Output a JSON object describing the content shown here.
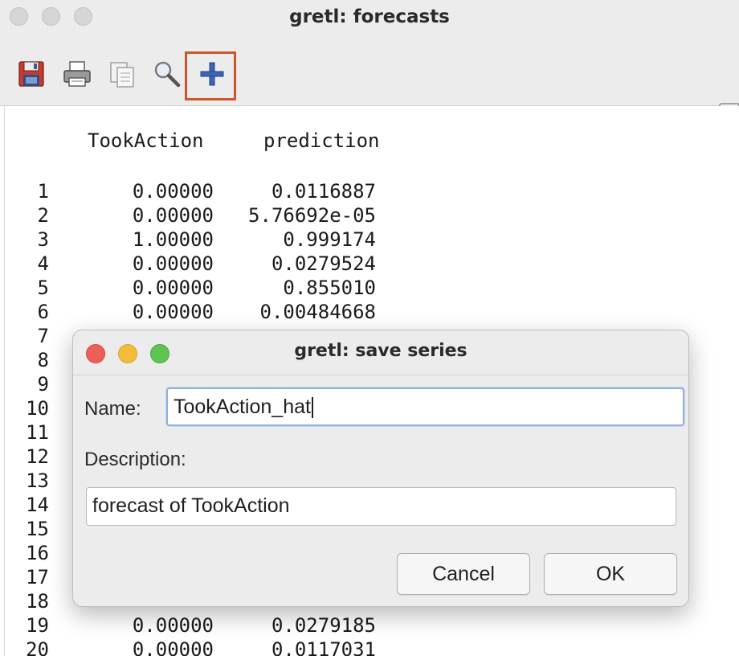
{
  "window": {
    "title": "gretl: forecasts"
  },
  "toolbar": {
    "items": [
      {
        "icon": "save-icon"
      },
      {
        "icon": "print-icon"
      },
      {
        "icon": "copy-icon"
      },
      {
        "icon": "find-icon"
      },
      {
        "icon": "add-series-icon"
      }
    ]
  },
  "table": {
    "headers": [
      "TookAction",
      "prediction"
    ],
    "rows": [
      {
        "n": "1",
        "took": "0.00000",
        "pred": "0.0116887"
      },
      {
        "n": "2",
        "took": "0.00000",
        "pred": "5.76692e-05"
      },
      {
        "n": "3",
        "took": "1.00000",
        "pred": "0.999174"
      },
      {
        "n": "4",
        "took": "0.00000",
        "pred": "0.0279524"
      },
      {
        "n": "5",
        "took": "0.00000",
        "pred": "0.855010"
      },
      {
        "n": "6",
        "took": "0.00000",
        "pred": "0.00484668"
      },
      {
        "n": "7",
        "took": "",
        "pred": ""
      },
      {
        "n": "8",
        "took": "",
        "pred": ""
      },
      {
        "n": "9",
        "took": "",
        "pred": ""
      },
      {
        "n": "10",
        "took": "",
        "pred": ""
      },
      {
        "n": "11",
        "took": "",
        "pred": ""
      },
      {
        "n": "12",
        "took": "",
        "pred": ""
      },
      {
        "n": "13",
        "took": "",
        "pred": ""
      },
      {
        "n": "14",
        "took": "",
        "pred": ""
      },
      {
        "n": "15",
        "took": "",
        "pred": ""
      },
      {
        "n": "16",
        "took": "",
        "pred": ""
      },
      {
        "n": "17",
        "took": "",
        "pred": ""
      },
      {
        "n": "18",
        "took": "",
        "pred": ""
      },
      {
        "n": "19",
        "took": "0.00000",
        "pred": "0.0279185"
      },
      {
        "n": "20",
        "took": "0.00000",
        "pred": "0.0117031"
      }
    ]
  },
  "dialog": {
    "title": "gretl: save series",
    "name_label": "Name:",
    "name_value": "TookAction_hat",
    "description_label": "Description:",
    "description_value": "forecast of TookAction",
    "cancel_label": "Cancel",
    "ok_label": "OK",
    "colors": {
      "close": "#ec5f56",
      "minimize": "#f3bd3a",
      "zoom": "#5fc453"
    }
  },
  "highlight_color": "#d0562a"
}
